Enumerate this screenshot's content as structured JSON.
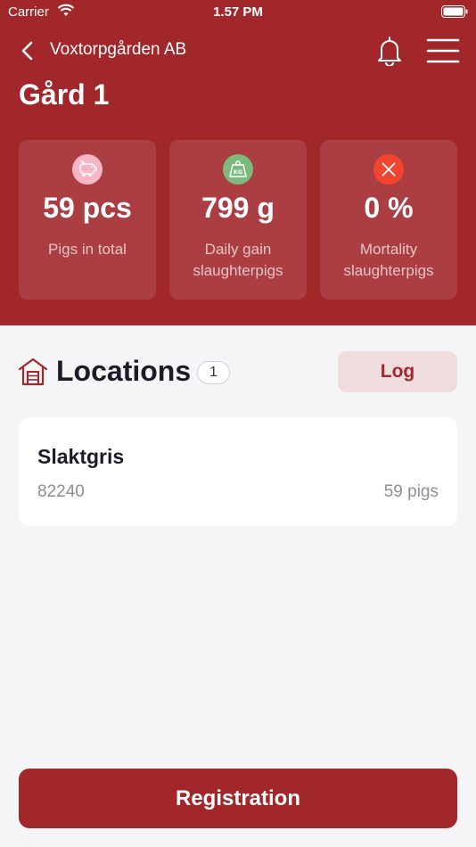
{
  "status_bar": {
    "carrier": "Carrier",
    "time": "1.57 PM"
  },
  "nav": {
    "title": "Voxtorpgården AB"
  },
  "farm": {
    "title": "Gård 1"
  },
  "stats": [
    {
      "icon": "pig-icon",
      "icon_color": "#f6b6c6",
      "value": "59 pcs",
      "label": "Pigs in total"
    },
    {
      "icon": "weight-icon",
      "icon_color": "#7dbb7d",
      "value": "799 g",
      "label": "Daily gain slaughterpigs"
    },
    {
      "icon": "close-circle-icon",
      "icon_color": "#f2452f",
      "value": "0 %",
      "label": "Mortality slaughterpigs"
    }
  ],
  "locations": {
    "title": "Locations",
    "count": "1",
    "log_label": "Log"
  },
  "location_items": [
    {
      "name": "Slaktgris",
      "code": "82240",
      "count": "59 pigs"
    }
  ],
  "registration_label": "Registration",
  "colors": {
    "brand": "#a1272b",
    "background": "#f5f5f8",
    "log_button_bg": "#efdcdc"
  }
}
